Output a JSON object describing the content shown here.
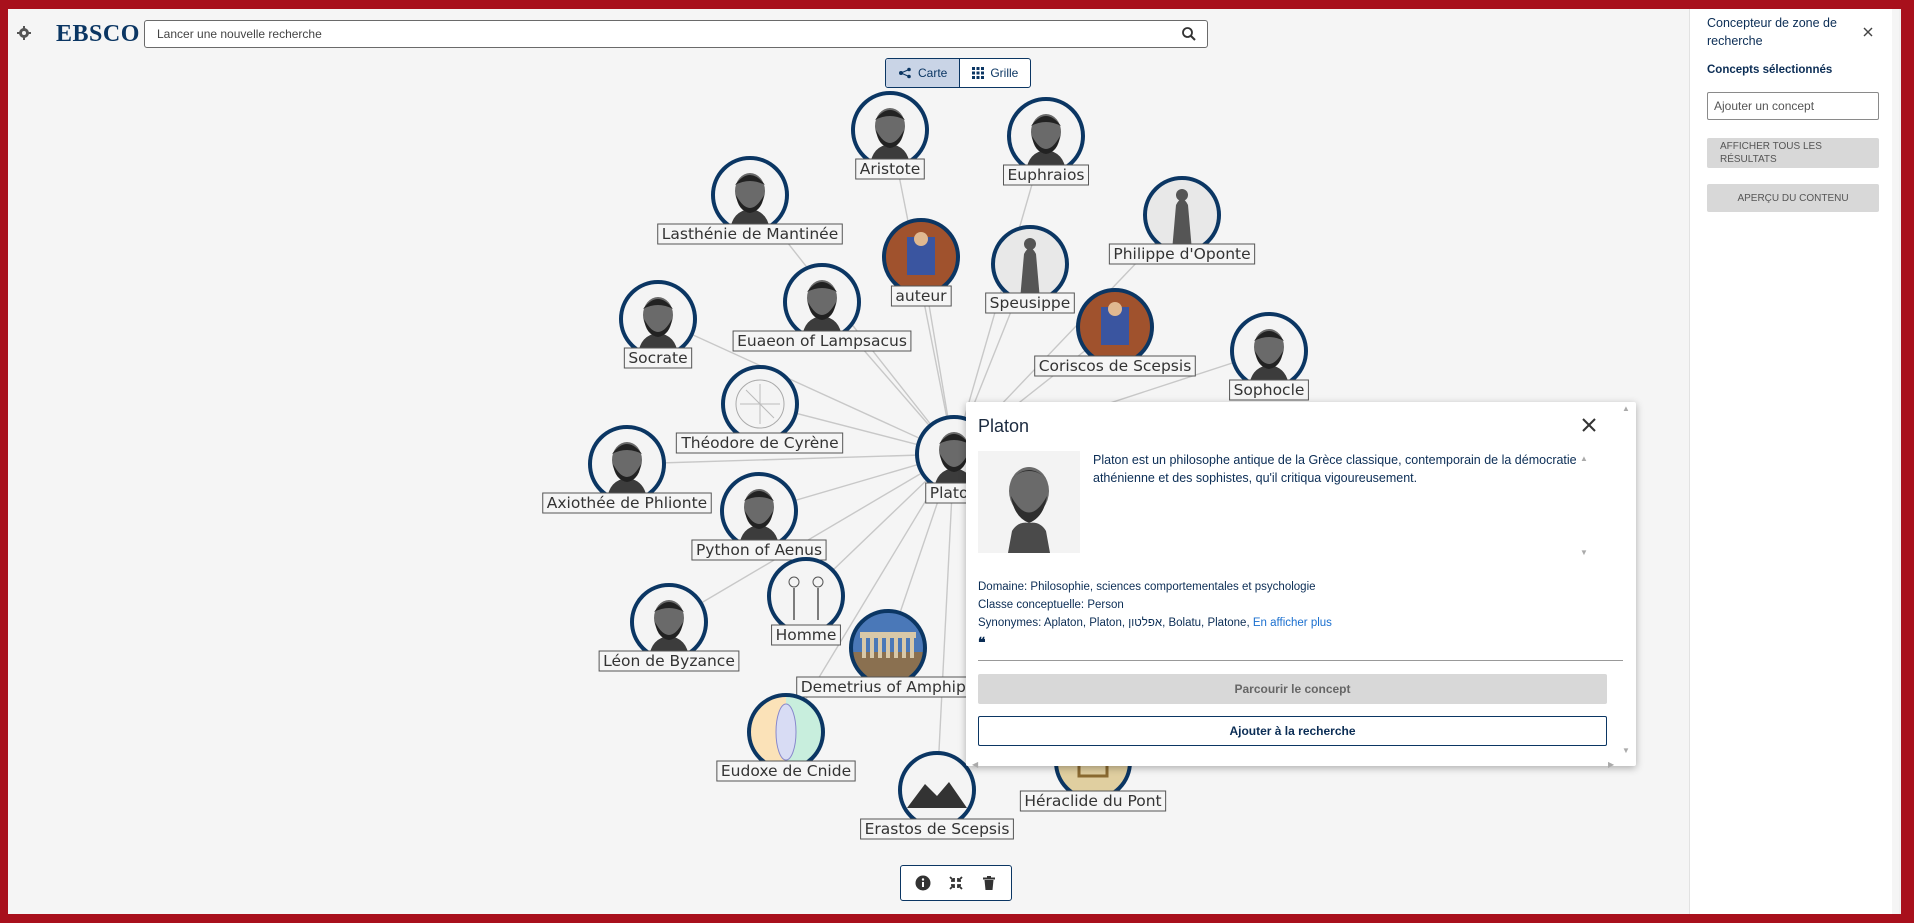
{
  "header": {
    "logo": "EBSCO",
    "search_placeholder": "Lancer une nouvelle recherche"
  },
  "view_toggle": {
    "map_label": "Carte",
    "grid_label": "Grille",
    "active": "Carte"
  },
  "graph": {
    "center": "Platon",
    "nodes": [
      {
        "label": "Aristote",
        "icon": "bust-portrait"
      },
      {
        "label": "Euphraios",
        "icon": "bust-portrait"
      },
      {
        "label": "Lasthénie de Mantinée",
        "icon": "bust-portrait"
      },
      {
        "label": "auteur",
        "icon": "painting"
      },
      {
        "label": "Philippe d'Oponte",
        "icon": "statue"
      },
      {
        "label": "Speusippe",
        "icon": "statue"
      },
      {
        "label": "Euaeon of Lampsacus",
        "icon": "bust-portrait"
      },
      {
        "label": "Socrate",
        "icon": "bust-portrait"
      },
      {
        "label": "Coriscos de Scepsis",
        "icon": "painting"
      },
      {
        "label": "Sophocle",
        "icon": "bust-portrait"
      },
      {
        "label": "Théodore de Cyrène",
        "icon": "diagram"
      },
      {
        "label": "Platon",
        "icon": "bust-portrait"
      },
      {
        "label": "Axiothée de Phlionte",
        "icon": "bust-portrait"
      },
      {
        "label": "Python of Aenus",
        "icon": "bust-portrait"
      },
      {
        "label": "Homme",
        "icon": "figures"
      },
      {
        "label": "Léon de Byzance",
        "icon": "bust-portrait"
      },
      {
        "label": "Demetrius of Amphipo",
        "icon": "temple"
      },
      {
        "label": "Eudoxe de Cnide",
        "icon": "ellipses"
      },
      {
        "label": "Erastos de Scepsis",
        "icon": "placeholder-mountains"
      },
      {
        "label": "Héraclide du Pont",
        "icon": "seal"
      }
    ]
  },
  "popup": {
    "title": "Platon",
    "description": "Platon est un philosophe antique de la Grèce classique, contemporain de la démocratie athénienne et des sophistes, qu'il critiqua vigoureusement.",
    "domain_label": "Domaine: ",
    "domain_value": "Philosophie, sciences comportementales et psychologie",
    "class_label": "Classe conceptuelle: ",
    "class_value": "Person",
    "synonyms_label": "Synonymes: ",
    "synonyms_value": "Aplaton, Platon, אפלטון, Bolatu, Platone, ",
    "more_link": "En afficher plus",
    "browse_button": "Parcourir le concept",
    "add_button": "Ajouter à la recherche"
  },
  "panel": {
    "title": "Concepteur de zone de recherche",
    "subtitle": "Concepts sélectionnés",
    "concept_placeholder": "Ajouter un concept",
    "show_all_button": "AFFICHER TOUS LES RÉSULTATS",
    "preview_button": "APERÇU DU CONTENU"
  },
  "colors": {
    "accent": "#0b3663",
    "frame": "#a8101c",
    "link": "#1a6fcf"
  }
}
